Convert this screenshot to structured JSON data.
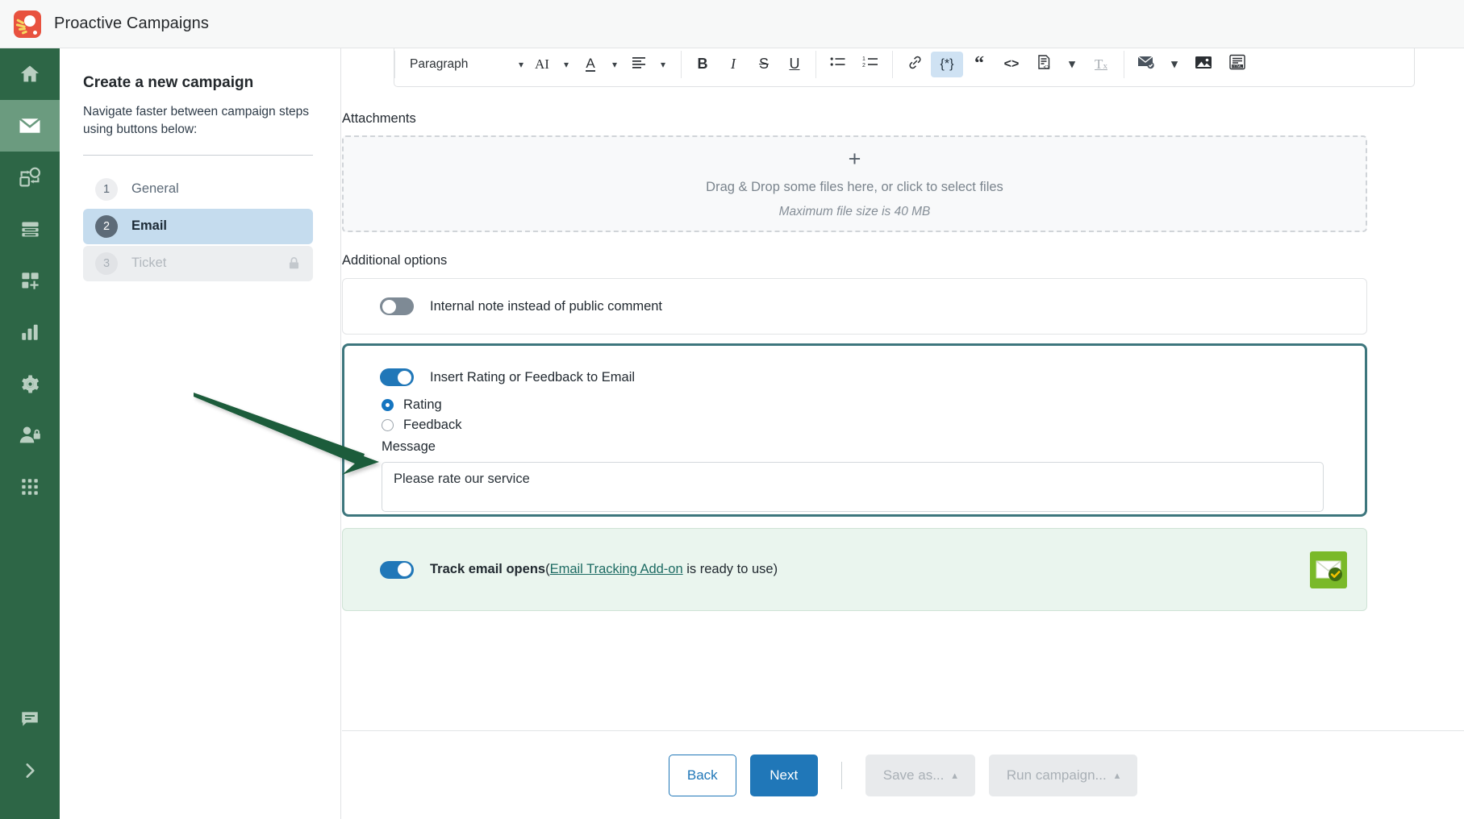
{
  "app": {
    "title": "Proactive Campaigns",
    "logo_icon": "proactive-campaigns-logo"
  },
  "rail": {
    "items": [
      {
        "icon": "home-icon",
        "name": "home",
        "active": false
      },
      {
        "icon": "envelope-icon",
        "name": "campaigns",
        "active": true
      },
      {
        "icon": "automation-icon",
        "name": "automations",
        "active": false
      },
      {
        "icon": "database-icon",
        "name": "data",
        "active": false
      },
      {
        "icon": "add-widget-icon",
        "name": "apps-add",
        "active": false
      },
      {
        "icon": "bar-chart-icon",
        "name": "reports",
        "active": false
      },
      {
        "icon": "gear-icon",
        "name": "settings",
        "active": false
      },
      {
        "icon": "user-lock-icon",
        "name": "permissions",
        "active": false
      },
      {
        "icon": "grid-dots-icon",
        "name": "all-apps",
        "active": false
      }
    ],
    "bottom_items": [
      {
        "icon": "chat-icon",
        "name": "support-chat"
      },
      {
        "icon": "chevron-right-icon",
        "name": "expand-sidebar"
      }
    ]
  },
  "steps_panel": {
    "title": "Create a new campaign",
    "subtitle": "Navigate faster between campaign steps using buttons below:",
    "steps": [
      {
        "num": "1",
        "label": "General",
        "state": "done"
      },
      {
        "num": "2",
        "label": "Email",
        "state": "active"
      },
      {
        "num": "3",
        "label": "Ticket",
        "state": "locked",
        "lock_icon": "lock-icon"
      }
    ]
  },
  "editor_toolbar": {
    "paragraph_style": "Paragraph",
    "buttons": [
      {
        "name": "ai-assist",
        "icon": "AI",
        "label": "AI"
      },
      {
        "name": "text-color",
        "icon": "text-color-icon",
        "label": "A"
      },
      {
        "name": "align",
        "icon": "align-left-icon",
        "label": "≡"
      },
      {
        "name": "bold",
        "icon": "bold-icon",
        "label": "B"
      },
      {
        "name": "italic",
        "icon": "italic-icon",
        "label": "I"
      },
      {
        "name": "strikethrough",
        "icon": "strikethrough-icon",
        "label": "S"
      },
      {
        "name": "underline",
        "icon": "underline-icon",
        "label": "U"
      },
      {
        "name": "bullet-list",
        "icon": "bullet-list-icon",
        "label": ""
      },
      {
        "name": "numbered-list",
        "icon": "numbered-list-icon",
        "label": ""
      },
      {
        "name": "insert-link",
        "icon": "link-icon",
        "label": ""
      },
      {
        "name": "placeholder",
        "icon": "placeholder-icon",
        "label": "{*}",
        "active": true
      },
      {
        "name": "blockquote",
        "icon": "quote-icon",
        "label": "“"
      },
      {
        "name": "code",
        "icon": "code-icon",
        "label": "<>"
      },
      {
        "name": "template",
        "icon": "template-icon",
        "label": ""
      },
      {
        "name": "clear-formatting",
        "icon": "clear-format-icon",
        "label": "Tx"
      },
      {
        "name": "email-template",
        "icon": "email-check-icon",
        "label": ""
      },
      {
        "name": "insert-image",
        "icon": "image-icon",
        "label": ""
      },
      {
        "name": "html-source",
        "icon": "html-icon",
        "label": "HTML"
      }
    ]
  },
  "attachments": {
    "title": "Attachments",
    "plus_icon": "plus-icon",
    "drop_text": "Drag & Drop some files here, or click to select files",
    "max_size_text": "Maximum file size is 40 MB"
  },
  "additional_options": {
    "title": "Additional options",
    "internal_note": {
      "label": "Internal note instead of public comment",
      "toggle_on": false
    },
    "rating_feedback": {
      "label": "Insert Rating or Feedback to Email",
      "toggle_on": true,
      "options": [
        {
          "label": "Rating",
          "selected": true
        },
        {
          "label": "Feedback",
          "selected": false
        }
      ],
      "message_label": "Message",
      "message_value": "Please rate our service",
      "highlight_color": "#3d767d"
    },
    "track_opens": {
      "label_prefix": "Track email opens",
      "paren_open": "(",
      "link_text": "Email Tracking Add-on",
      "label_suffix": " is ready to use)",
      "toggle_on": true,
      "badge_icon": "email-tracking-icon",
      "badge_color": "#7ab929"
    }
  },
  "footer": {
    "back_label": "Back",
    "next_label": "Next",
    "save_as_label": "Save as...",
    "run_campaign_label": "Run campaign...",
    "caret_icon": "chevron-up-icon"
  },
  "annotation": {
    "arrow_color": "#1f5c3b",
    "name": "pointer-arrow"
  }
}
